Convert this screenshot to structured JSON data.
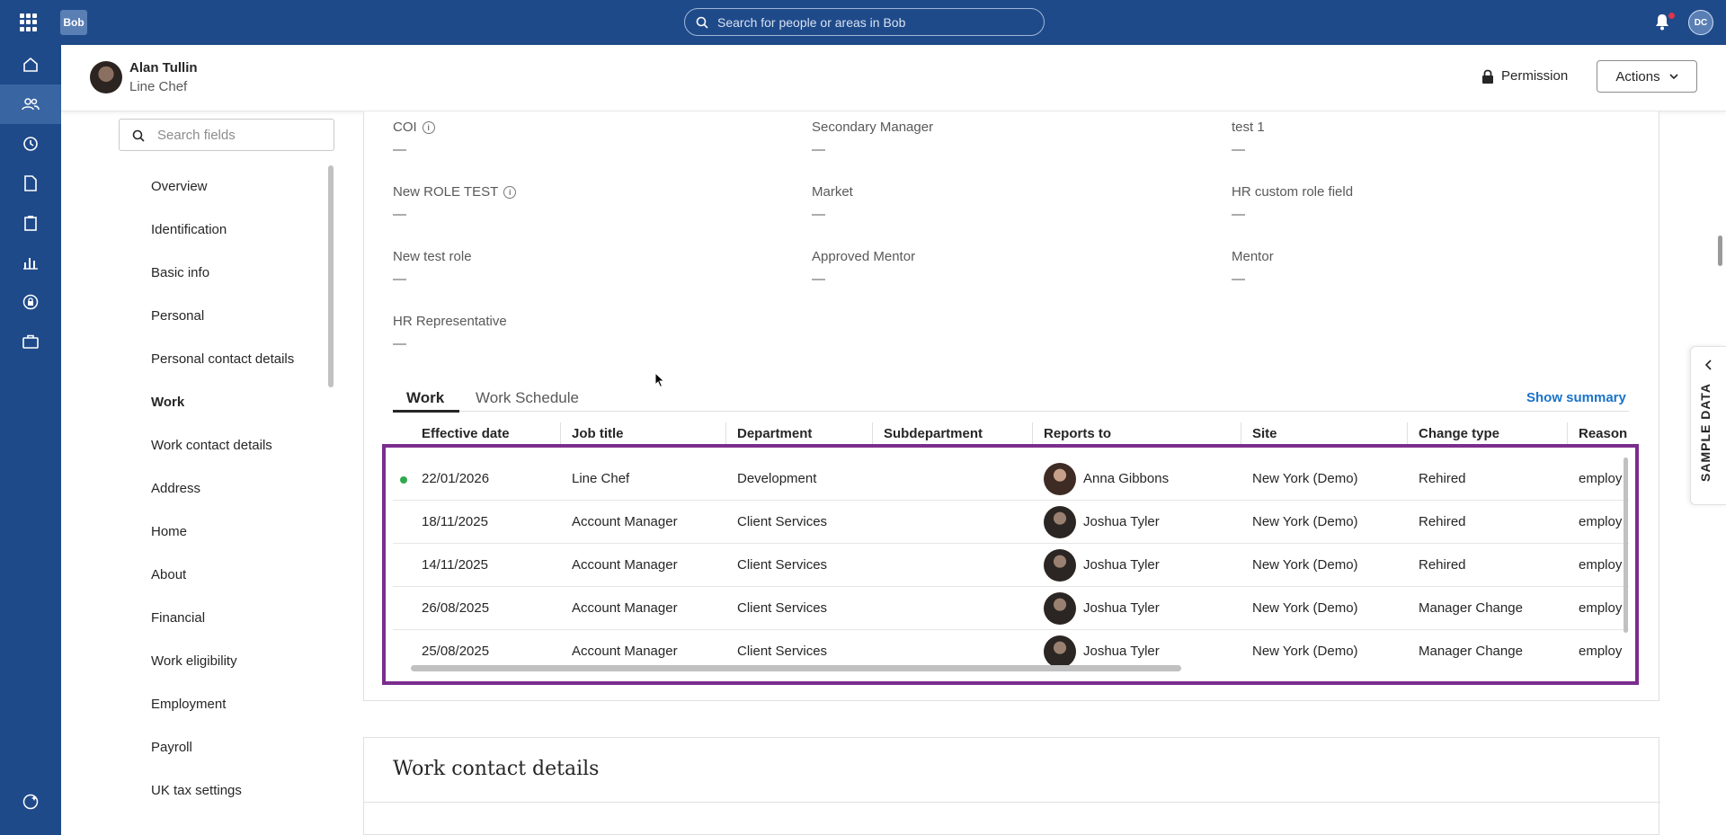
{
  "topbar": {
    "logo": "Bob",
    "search_placeholder": "Search for people or areas in Bob",
    "user_initials": "DC"
  },
  "employee": {
    "name": "Alan Tullin",
    "title": "Line Chef",
    "permission_label": "Permission",
    "actions_label": "Actions"
  },
  "field_search_placeholder": "Search fields",
  "nav": [
    {
      "label": "Overview"
    },
    {
      "label": "Identification"
    },
    {
      "label": "Basic info"
    },
    {
      "label": "Personal"
    },
    {
      "label": "Personal contact details"
    },
    {
      "label": "Work"
    },
    {
      "label": "Work contact details"
    },
    {
      "label": "Address"
    },
    {
      "label": "Home"
    },
    {
      "label": "About"
    },
    {
      "label": "Financial"
    },
    {
      "label": "Work eligibility"
    },
    {
      "label": "Employment"
    },
    {
      "label": "Payroll"
    },
    {
      "label": "UK tax settings"
    }
  ],
  "fields": {
    "coi": {
      "label": "COI",
      "value": "—"
    },
    "secondary_manager": {
      "label": "Secondary Manager",
      "value": "—"
    },
    "test1": {
      "label": "test 1",
      "value": "—"
    },
    "new_role_test": {
      "label": "New ROLE TEST",
      "value": "—"
    },
    "market": {
      "label": "Market",
      "value": "—"
    },
    "hr_custom_role": {
      "label": "HR custom role field",
      "value": "—"
    },
    "new_test_role": {
      "label": "New test role",
      "value": "—"
    },
    "approved_mentor": {
      "label": "Approved Mentor",
      "value": "—"
    },
    "mentor": {
      "label": "Mentor",
      "value": "—"
    },
    "hr_rep": {
      "label": "HR Representative",
      "value": "—"
    }
  },
  "tabs": {
    "work": "Work",
    "work_schedule": "Work Schedule",
    "show_summary": "Show summary"
  },
  "table": {
    "columns": [
      "Effective date",
      "Job title",
      "Department",
      "Subdepartment",
      "Reports to",
      "Site",
      "Change type",
      "Reason"
    ],
    "rows": [
      {
        "date": "22/01/2026",
        "job": "Line Chef",
        "dept": "Development",
        "subdept": "",
        "reports_to": "Anna Gibbons",
        "site": "New York (Demo)",
        "change": "Rehired",
        "reason": "employ"
      },
      {
        "date": "18/11/2025",
        "job": "Account Manager",
        "dept": "Client Services",
        "subdept": "",
        "reports_to": "Joshua Tyler",
        "site": "New York (Demo)",
        "change": "Rehired",
        "reason": "employ"
      },
      {
        "date": "14/11/2025",
        "job": "Account Manager",
        "dept": "Client Services",
        "subdept": "",
        "reports_to": "Joshua Tyler",
        "site": "New York (Demo)",
        "change": "Rehired",
        "reason": "employ"
      },
      {
        "date": "26/08/2025",
        "job": "Account Manager",
        "dept": "Client Services",
        "subdept": "",
        "reports_to": "Joshua Tyler",
        "site": "New York (Demo)",
        "change": "Manager Change",
        "reason": "employ"
      },
      {
        "date": "25/08/2025",
        "job": "Account Manager",
        "dept": "Client Services",
        "subdept": "",
        "reports_to": "Joshua Tyler",
        "site": "New York (Demo)",
        "change": "Manager Change",
        "reason": "employ"
      }
    ]
  },
  "section2_title": "Work contact details",
  "sample_data_label": "SAMPLE DATA",
  "colors": {
    "topbar": "#1f4a8a",
    "highlight": "#7b2d8e",
    "link": "#1a73c9",
    "active_dot": "#2fa84f"
  }
}
